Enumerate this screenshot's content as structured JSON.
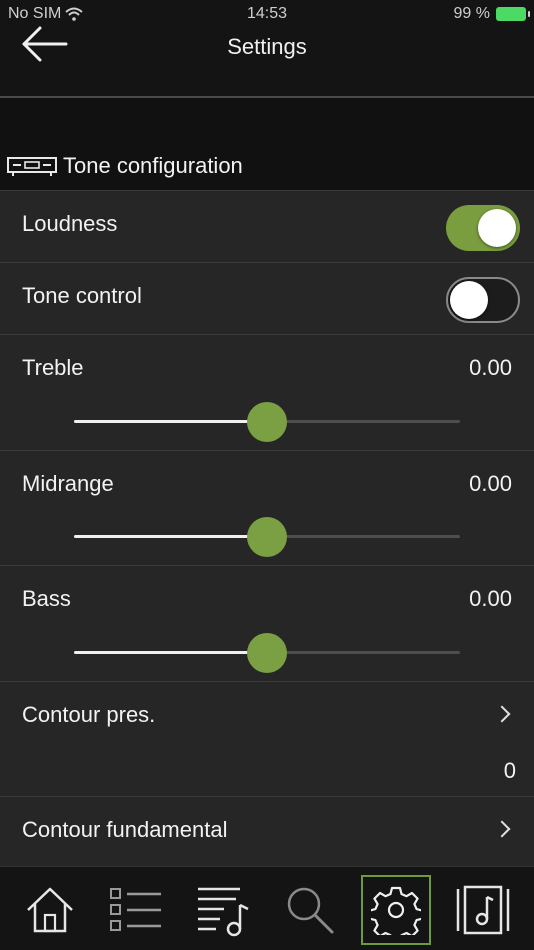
{
  "status": {
    "carrier": "No SIM",
    "time": "14:53",
    "battery": "99 %"
  },
  "nav": {
    "title": "Settings"
  },
  "section": {
    "title": "Tone configuration"
  },
  "rows": {
    "loudness": {
      "label": "Loudness",
      "on": true
    },
    "tone_control": {
      "label": "Tone control",
      "on": false
    },
    "treble": {
      "label": "Treble",
      "value": "0.00",
      "position": 0.5
    },
    "midrange": {
      "label": "Midrange",
      "value": "0.00",
      "position": 0.5
    },
    "bass": {
      "label": "Bass",
      "value": "0.00",
      "position": 0.5
    },
    "contour_pres": {
      "label": "Contour pres.",
      "value": "0"
    },
    "contour_fundamental": {
      "label": "Contour fundamental"
    }
  },
  "tabs": [
    {
      "icon": "home-icon",
      "active": false
    },
    {
      "icon": "list-icon",
      "active": false
    },
    {
      "icon": "playlist-icon",
      "active": false
    },
    {
      "icon": "search-icon",
      "active": false
    },
    {
      "icon": "gear-icon",
      "active": true
    },
    {
      "icon": "music-library-icon",
      "active": false
    }
  ],
  "colors": {
    "accent": "#7ba043",
    "background": "#111111",
    "row_background": "#262626"
  }
}
